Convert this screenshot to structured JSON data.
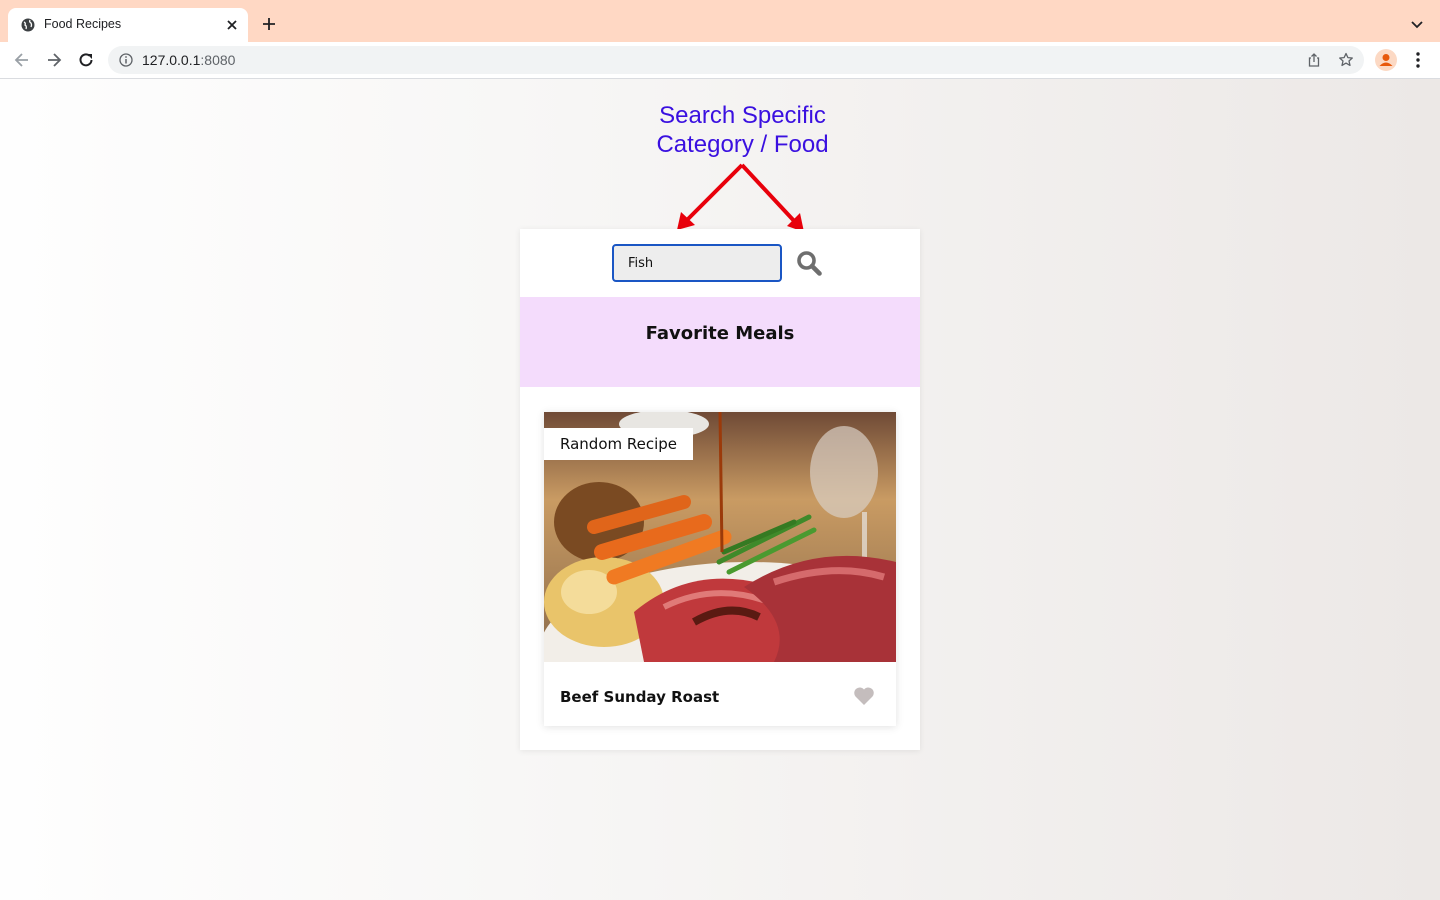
{
  "browser": {
    "tab_title": "Food Recipes",
    "url_host": "127.0.0.1",
    "url_port": ":8080"
  },
  "annotation": {
    "line1": "Search Specific",
    "line2": "Category / Food",
    "color": "#3a10e0",
    "arrow_color": "#e8000b"
  },
  "search": {
    "value": "Fish",
    "focus_color": "#1a56c4"
  },
  "favorites": {
    "title": "Favorite Meals",
    "background": "#f4dcfc"
  },
  "meal": {
    "badge": "Random Recipe",
    "name": "Beef Sunday Roast",
    "favorited": false
  },
  "icons": {
    "favicon": "globe-icon",
    "tab_close": "close-icon",
    "new_tab": "plus-icon",
    "back": "back-arrow-icon",
    "forward": "forward-arrow-icon",
    "reload": "reload-icon",
    "site_info": "info-icon",
    "share": "share-icon",
    "bookmark": "star-icon",
    "profile": "profile-icon",
    "menu": "kebab-menu-icon",
    "search": "search-icon",
    "favorite": "heart-icon"
  }
}
